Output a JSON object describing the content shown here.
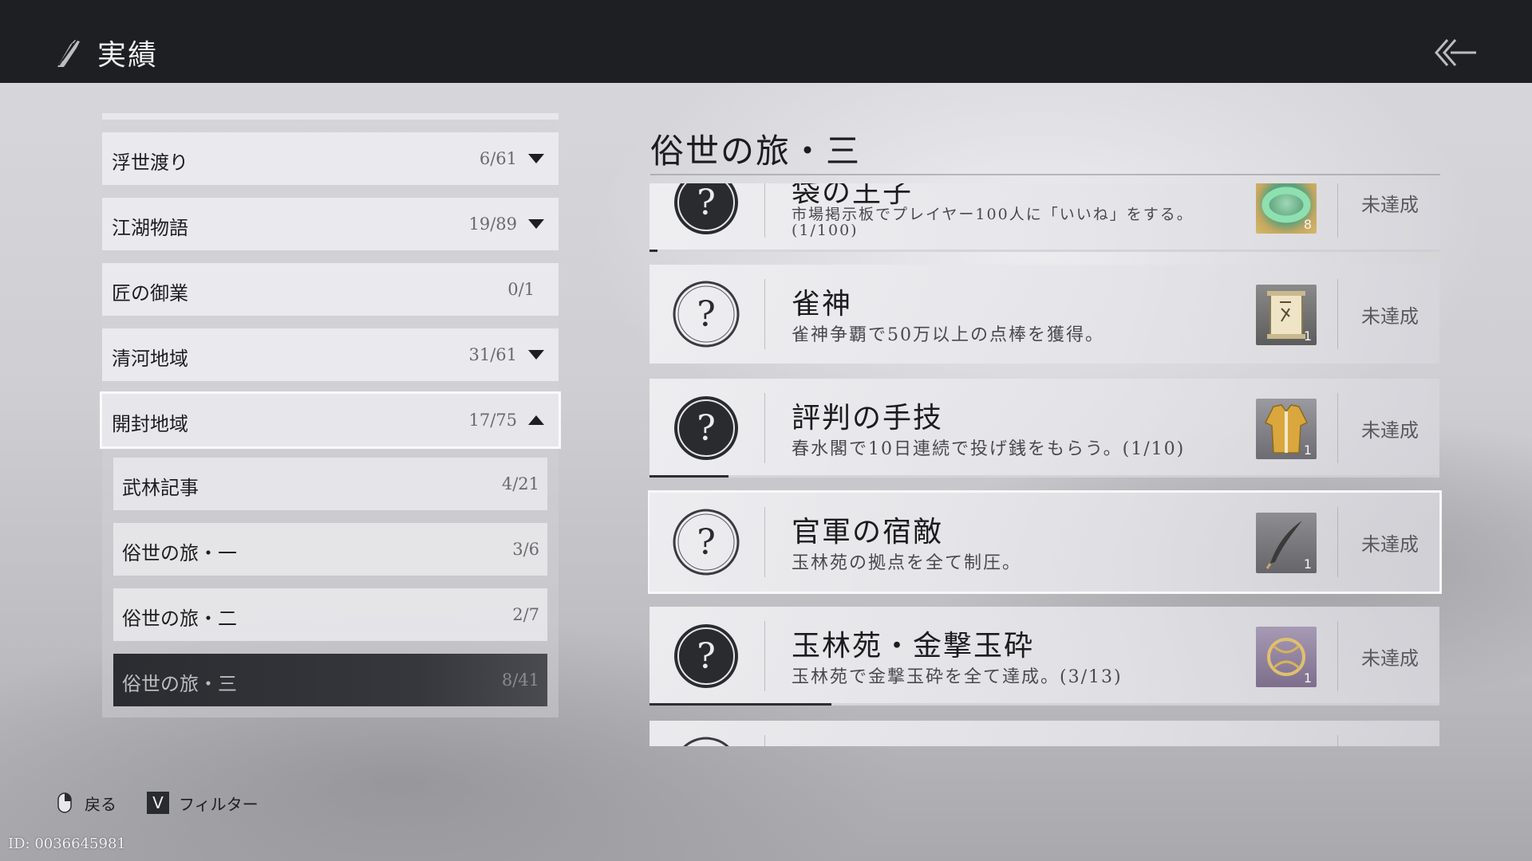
{
  "header": {
    "title": "実績",
    "logo_icon": "brush-stroke-icon",
    "back_icon": "double-chevron-left-icon"
  },
  "categories": [
    {
      "label": "浮世渡り",
      "count": "6/61",
      "expanded": false,
      "has_toggle": true
    },
    {
      "label": "江湖物語",
      "count": "19/89",
      "expanded": false,
      "has_toggle": true
    },
    {
      "label": "匠の御業",
      "count": "0/1",
      "expanded": false,
      "has_toggle": false
    },
    {
      "label": "清河地域",
      "count": "31/61",
      "expanded": false,
      "has_toggle": true
    },
    {
      "label": "開封地域",
      "count": "17/75",
      "expanded": true,
      "has_toggle": true,
      "selected": true
    }
  ],
  "subcategories": [
    {
      "label": "武林記事",
      "count": "4/21"
    },
    {
      "label": "俗世の旅・一",
      "count": "3/6"
    },
    {
      "label": "俗世の旅・二",
      "count": "2/7"
    },
    {
      "label": "俗世の旅・三",
      "count": "8/41",
      "active": true
    }
  ],
  "section_title": "俗世の旅・三",
  "achievements": [
    {
      "name": "袋の王子",
      "desc": "市場掲示板でプレイヤー100人に「いいね」をする。",
      "desc2": "(1/100)",
      "status": "未達成",
      "reward_icon": "jade-bracelet-icon",
      "reward_qty": "8",
      "progress": 0.01,
      "partial": true
    },
    {
      "name": "雀神",
      "desc": "雀神争覇で50万以上の点棒を獲得。",
      "status": "未達成",
      "reward_icon": "title-scroll-icon",
      "reward_qty": "1",
      "progress": 0
    },
    {
      "name": "評判の手技",
      "desc": "春水閣で10日連続で投げ銭をもらう。(1/10)",
      "status": "未達成",
      "reward_icon": "golden-robe-icon",
      "reward_qty": "1",
      "progress": 0.1
    },
    {
      "name": "官軍の宿敵",
      "desc": "玉林苑の拠点を全て制圧。",
      "status": "未達成",
      "reward_icon": "feather-quill-icon",
      "reward_qty": "1",
      "progress": 0,
      "selected": true
    },
    {
      "name": "玉林苑・金撃玉砕",
      "desc": "玉林苑で金撃玉砕を全て達成。(3/13)",
      "status": "未達成",
      "reward_icon": "golden-emblem-icon",
      "reward_qty": "1",
      "progress": 0.23
    }
  ],
  "hints": {
    "back_label": "戻る",
    "filter_key": "V",
    "filter_label": "フィルター"
  },
  "player_id": "ID: 0036645981"
}
